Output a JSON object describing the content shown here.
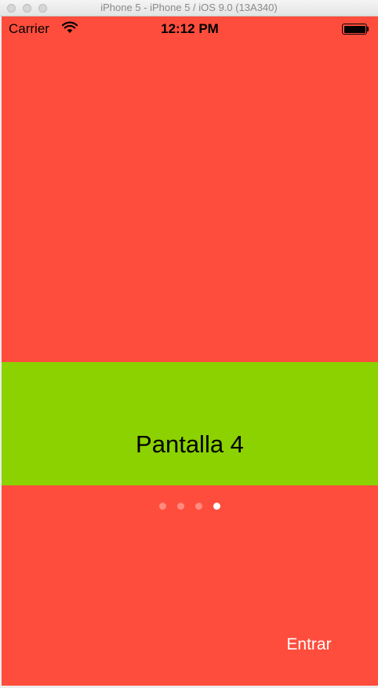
{
  "window": {
    "title": "iPhone 5 - iPhone 5 / iOS 9.0 (13A340)"
  },
  "status_bar": {
    "carrier": "Carrier",
    "time": "12:12 PM"
  },
  "screen": {
    "banner_text": "Pantalla 4",
    "enter_label": "Entrar",
    "page_control": {
      "total": 4,
      "current": 4
    }
  },
  "colors": {
    "background": "#ff4d3d",
    "banner": "#8bd200",
    "dot_active": "#ffffff",
    "enter_text": "#ffffff"
  },
  "icons": {
    "wifi": "wifi-icon",
    "battery": "battery-icon"
  }
}
